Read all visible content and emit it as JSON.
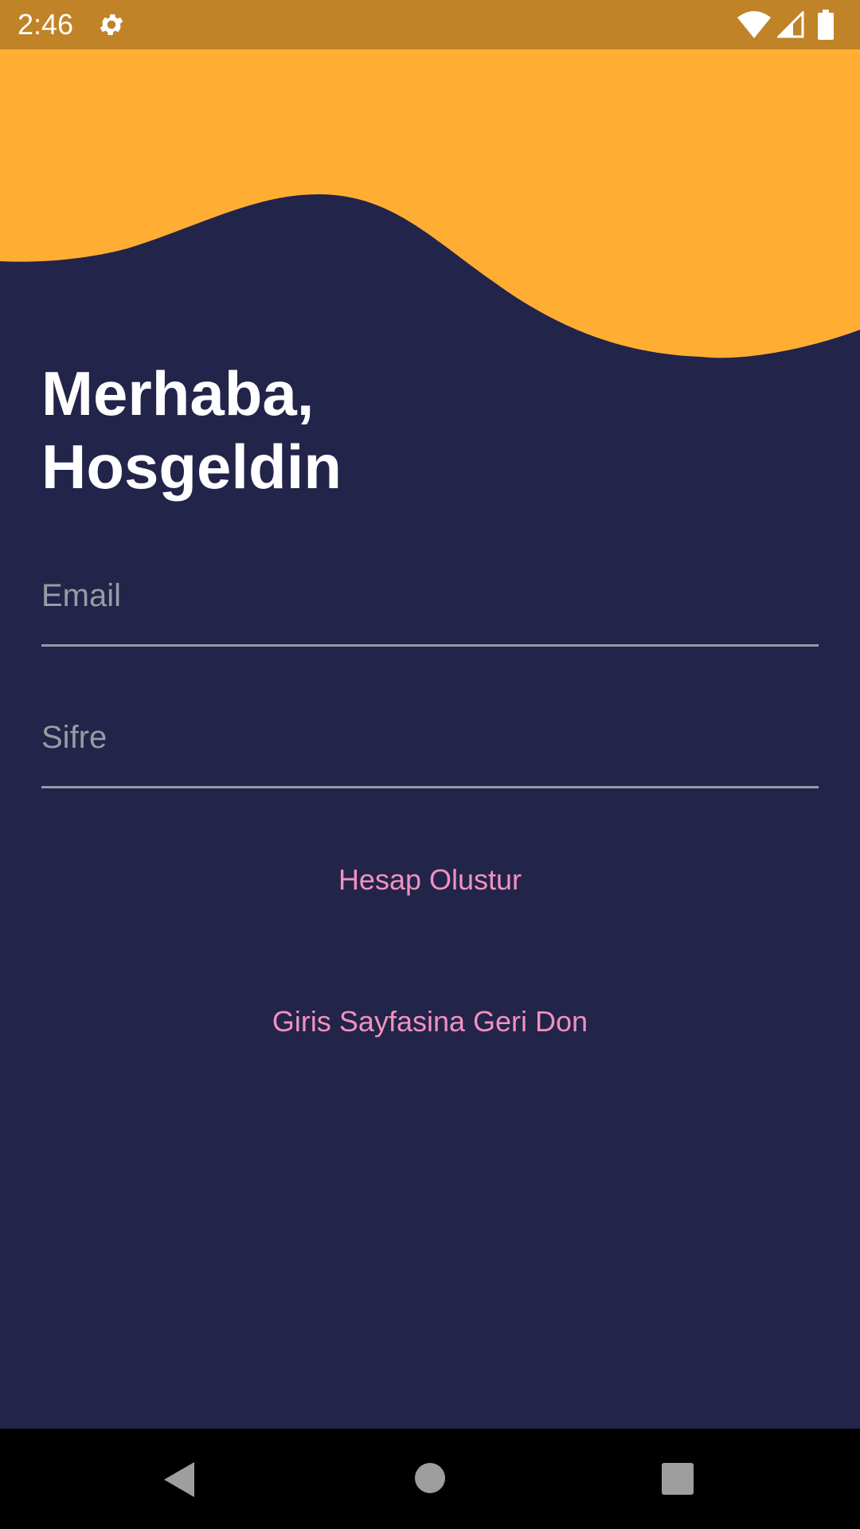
{
  "status_bar": {
    "time": "2:46",
    "settings_icon": "gear-icon",
    "wifi_icon": "wifi-icon",
    "signal_icon": "signal-icon",
    "battery_icon": "battery-icon",
    "background_color": "#C08328"
  },
  "header": {
    "wave_color": "#FFAE33",
    "background_color": "#22244A"
  },
  "greeting": {
    "line1": "Merhaba,",
    "line2": "Hosgeldin"
  },
  "form": {
    "email_placeholder": "Email",
    "password_placeholder": "Sifre"
  },
  "actions": {
    "create_account_label": "Hesap Olustur",
    "back_to_login_label": "Giris Sayfasina Geri Don",
    "link_color": "#F291BE"
  },
  "nav_bar": {
    "back_icon": "back-triangle-icon",
    "home_icon": "home-circle-icon",
    "recents_icon": "recents-square-icon"
  }
}
